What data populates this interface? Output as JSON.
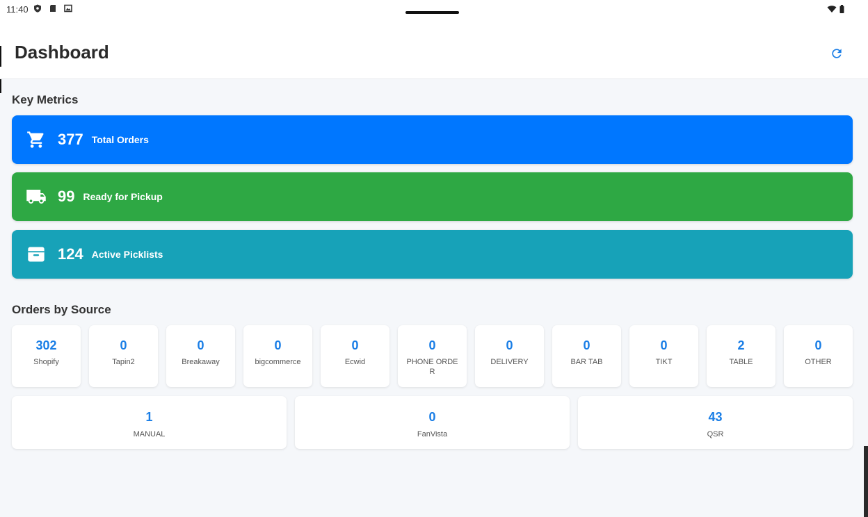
{
  "status_bar": {
    "time": "11:40"
  },
  "header": {
    "title": "Dashboard",
    "refresh_icon": "refresh-icon"
  },
  "key_metrics": {
    "title": "Key Metrics",
    "cards": [
      {
        "value": "377",
        "label": "Total Orders",
        "icon": "cart-icon",
        "color": "#0077ff"
      },
      {
        "value": "99",
        "label": "Ready for Pickup",
        "icon": "truck-icon",
        "color": "#2ea844"
      },
      {
        "value": "124",
        "label": "Active Picklists",
        "icon": "archive-icon",
        "color": "#17a2b8"
      }
    ]
  },
  "orders_by_source": {
    "title": "Orders by Source",
    "row1": [
      {
        "count": "302",
        "name": "Shopify"
      },
      {
        "count": "0",
        "name": "Tapin2"
      },
      {
        "count": "0",
        "name": "Breakaway"
      },
      {
        "count": "0",
        "name": "bigcommerce"
      },
      {
        "count": "0",
        "name": "Ecwid"
      },
      {
        "count": "0",
        "name": "PHONE ORDER"
      },
      {
        "count": "0",
        "name": "DELIVERY"
      },
      {
        "count": "0",
        "name": "BAR TAB"
      },
      {
        "count": "0",
        "name": "TIKT"
      },
      {
        "count": "2",
        "name": "TABLE"
      },
      {
        "count": "0",
        "name": "OTHER"
      }
    ],
    "row2": [
      {
        "count": "1",
        "name": "MANUAL"
      },
      {
        "count": "0",
        "name": "FanVista"
      },
      {
        "count": "43",
        "name": "QSR"
      }
    ]
  },
  "colors": {
    "accent": "#1a7ee6"
  }
}
